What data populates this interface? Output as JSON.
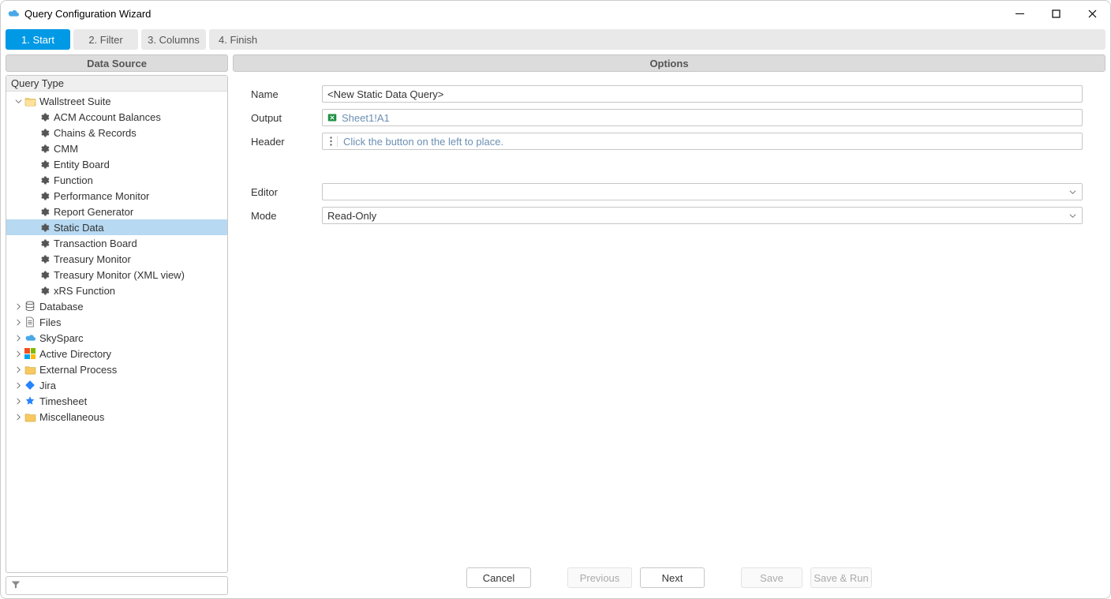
{
  "window": {
    "title": "Query Configuration Wizard"
  },
  "tabs": {
    "t0": "1. Start",
    "t1": "2. Filter",
    "t2": "3. Columns",
    "t3": "4. Finish"
  },
  "left": {
    "header": "Data Source",
    "group": "Query Type",
    "nodes": {
      "ws": "Wallstreet Suite",
      "ws_children": {
        "c0": "ACM Account Balances",
        "c1": "Chains & Records",
        "c2": "CMM",
        "c3": "Entity Board",
        "c4": "Function",
        "c5": "Performance Monitor",
        "c6": "Report Generator",
        "c7": "Static Data",
        "c8": "Transaction Board",
        "c9": "Treasury Monitor",
        "c10": "Treasury Monitor (XML view)",
        "c11": "xRS Function"
      },
      "db": "Database",
      "files": "Files",
      "sky": "SkySparc",
      "ad": "Active Directory",
      "ext": "External Process",
      "jira": "Jira",
      "ts": "Timesheet",
      "misc": "Miscellaneous"
    }
  },
  "right": {
    "header": "Options",
    "labels": {
      "name": "Name",
      "output": "Output",
      "headerlbl": "Header",
      "editor": "Editor",
      "mode": "Mode"
    },
    "fields": {
      "name": "<New Static Data Query>",
      "output": "Sheet1!A1",
      "header_placeholder": "Click the button on the left to place.",
      "editor": "",
      "mode": "Read-Only"
    }
  },
  "footer": {
    "cancel": "Cancel",
    "prev": "Previous",
    "next": "Next",
    "save": "Save",
    "saverun": "Save & Run"
  }
}
